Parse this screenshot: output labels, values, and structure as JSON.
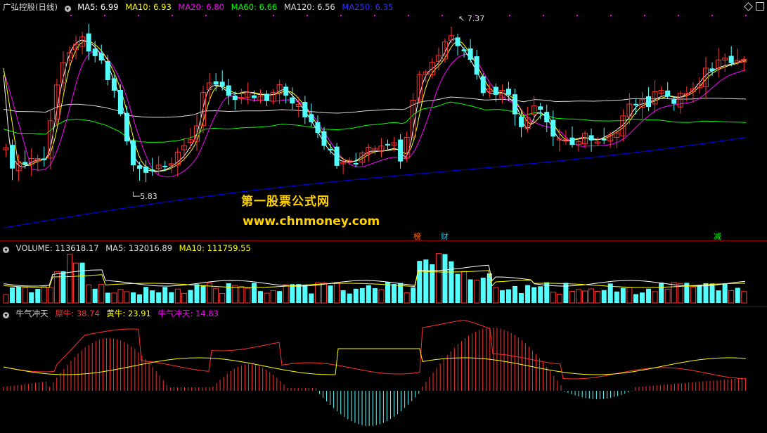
{
  "price_pane": {
    "title": "广弘控股(日线)",
    "ma_items": [
      {
        "label": "MA5: 6.99",
        "color": "#ffffff"
      },
      {
        "label": "MA10: 6.93",
        "color": "#ffff00"
      },
      {
        "label": "MA20: 6.80",
        "color": "#ff00ff"
      },
      {
        "label": "MA60: 6.66",
        "color": "#00ff00"
      },
      {
        "label": "MA120: 6.56",
        "color": "#dddddd"
      },
      {
        "label": "MA250: 6.35",
        "color": "#0000ff"
      }
    ],
    "high_marker": "7.37",
    "low_marker": "5.83",
    "events": [
      {
        "label": "榜",
        "color": "#ff6600"
      },
      {
        "label": "财",
        "color": "#00ccff"
      },
      {
        "label": "减",
        "color": "#00ff00"
      }
    ]
  },
  "watermark": {
    "line1": "第一股票公式网",
    "line2": "www.chnmoney.com"
  },
  "volume_pane": {
    "items": [
      {
        "label": "VOLUME: 113618.17",
        "color": "#dddddd"
      },
      {
        "label": "MA5: 132016.89",
        "color": "#dddddd"
      },
      {
        "label": "MA10: 111759.55",
        "color": "#ffff00"
      }
    ]
  },
  "indicator_pane": {
    "name": "牛气冲天",
    "items": [
      {
        "label": "犀牛: 38.74",
        "color": "#ff3030"
      },
      {
        "label": "黄牛: 23.91",
        "color": "#ffff00"
      },
      {
        "label": "牛气冲天: 14.83",
        "color": "#ff00ff"
      }
    ]
  },
  "colors": {
    "up": "#ff3232",
    "down": "#54ffff",
    "background": "#000000",
    "separator": "#8b0000"
  }
}
